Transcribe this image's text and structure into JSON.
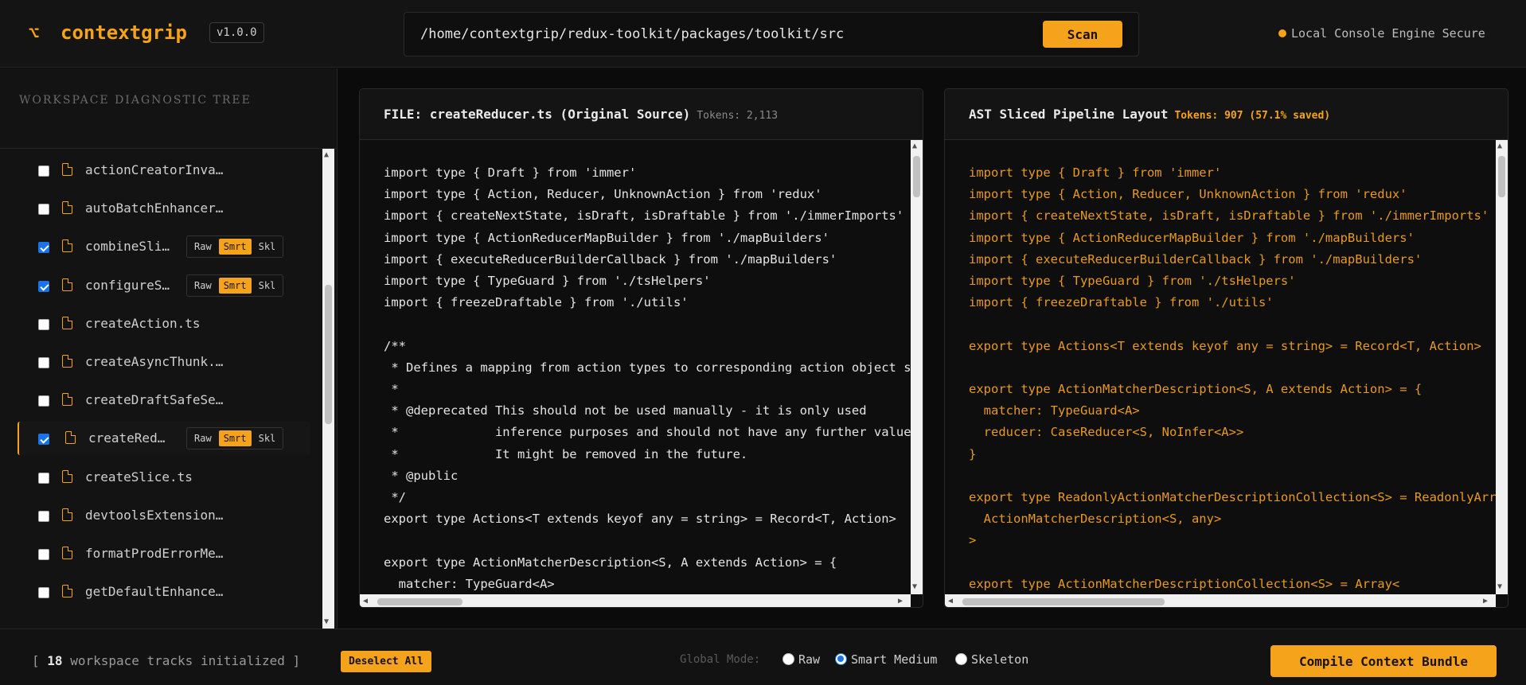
{
  "header": {
    "logo_mark": "⌥",
    "brand": "contextgrip",
    "version": "v1.0.0",
    "path_value": "/home/contextgrip/redux-toolkit/packages/toolkit/src",
    "scan_label": "Scan",
    "status_text": "Local Console Engine Secure"
  },
  "sidebar": {
    "title": "WORKSPACE DIAGNOSTIC TREE",
    "mode_labels": {
      "raw": "Raw",
      "smart": "Smrt",
      "skeleton": "Skl"
    },
    "items": [
      {
        "name": "actionCreatorInva…",
        "checked": false
      },
      {
        "name": "autoBatchEnhancer…",
        "checked": false
      },
      {
        "name": "combineSli…",
        "checked": true,
        "mode": "smart"
      },
      {
        "name": "configureS…",
        "checked": true,
        "mode": "smart"
      },
      {
        "name": "createAction.ts",
        "checked": false
      },
      {
        "name": "createAsyncThunk.…",
        "checked": false
      },
      {
        "name": "createDraftSafeSe…",
        "checked": false
      },
      {
        "name": "createRed…",
        "checked": true,
        "mode": "smart",
        "active": true
      },
      {
        "name": "createSlice.ts",
        "checked": false
      },
      {
        "name": "devtoolsExtension…",
        "checked": false
      },
      {
        "name": "formatProdErrorMe…",
        "checked": false
      },
      {
        "name": "getDefaultEnhance…",
        "checked": false
      }
    ]
  },
  "left_panel": {
    "title": "FILE: createReducer.ts (Original Source)",
    "tokens": "Tokens: 2,113",
    "code": "import type { Draft } from 'immer'\nimport type { Action, Reducer, UnknownAction } from 'redux'\nimport { createNextState, isDraft, isDraftable } from './immerImports'\nimport type { ActionReducerMapBuilder } from './mapBuilders'\nimport { executeReducerBuilderCallback } from './mapBuilders'\nimport type { TypeGuard } from './tsHelpers'\nimport { freezeDraftable } from './utils'\n\n/**\n * Defines a mapping from action types to corresponding action object shapes.\n *\n * @deprecated This should not be used manually - it is only used\n *             inference purposes and should not have any further value.\n *             It might be removed in the future.\n * @public\n */\nexport type Actions<T extends keyof any = string> = Record<T, Action>\n\nexport type ActionMatcherDescription<S, A extends Action> = {\n  matcher: TypeGuard<A>"
  },
  "right_panel": {
    "title": "AST Sliced Pipeline Layout",
    "tokens": "Tokens: 907 (57.1% saved)",
    "code": "import type { Draft } from 'immer'\nimport type { Action, Reducer, UnknownAction } from 'redux'\nimport { createNextState, isDraft, isDraftable } from './immerImports'\nimport type { ActionReducerMapBuilder } from './mapBuilders'\nimport { executeReducerBuilderCallback } from './mapBuilders'\nimport type { TypeGuard } from './tsHelpers'\nimport { freezeDraftable } from './utils'\n\nexport type Actions<T extends keyof any = string> = Record<T, Action>\n\nexport type ActionMatcherDescription<S, A extends Action> = {\n  matcher: TypeGuard<A>\n  reducer: CaseReducer<S, NoInfer<A>>\n}\n\nexport type ReadonlyActionMatcherDescriptionCollection<S> = ReadonlyArray<\n  ActionMatcherDescription<S, any>\n>\n\nexport type ActionMatcherDescriptionCollection<S> = Array<"
  },
  "footer": {
    "status_open": "[",
    "track_count": "18",
    "status_rest": "workspace tracks initialized ]",
    "deselect_label": "Deselect All",
    "global_mode_label": "Global Mode:",
    "modes": [
      "Raw",
      "Smart Medium",
      "Skeleton"
    ],
    "selected_mode": "Smart Medium",
    "compile_label": "Compile Context Bundle"
  },
  "colors": {
    "accent": "#f5a31a",
    "background": "#0b0b0c",
    "checkbox_checked": "#1a73e8"
  }
}
